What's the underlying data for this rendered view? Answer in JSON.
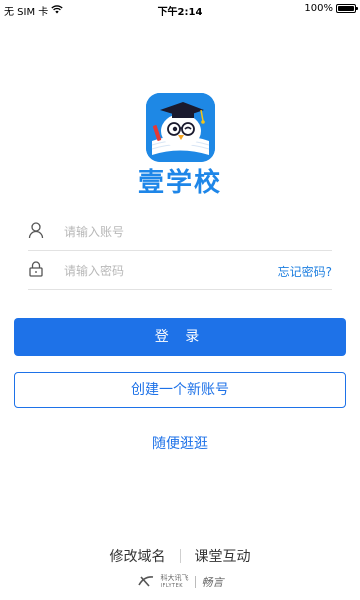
{
  "status_bar": {
    "carrier": "无 SIM 卡",
    "time": "下午2:14",
    "battery_percent": "100%",
    "battery_level": 1.0
  },
  "app": {
    "name": "壹学校",
    "logo_icon": "owl-graduate-logo",
    "brand_color": "#1e86e8"
  },
  "login_form": {
    "account_placeholder": "请输入账号",
    "password_placeholder": "请输入密码",
    "forgot_password": "忘记密码?"
  },
  "actions": {
    "login": "登 录",
    "create_account": "创建一个新账号",
    "browse": "随便逛逛"
  },
  "footer": {
    "modify_domain": "修改域名",
    "classroom_interaction": "课堂互动",
    "brand_cn": "科大讯飞",
    "brand_en": "IFLYTEK",
    "brand_product": "畅言"
  }
}
